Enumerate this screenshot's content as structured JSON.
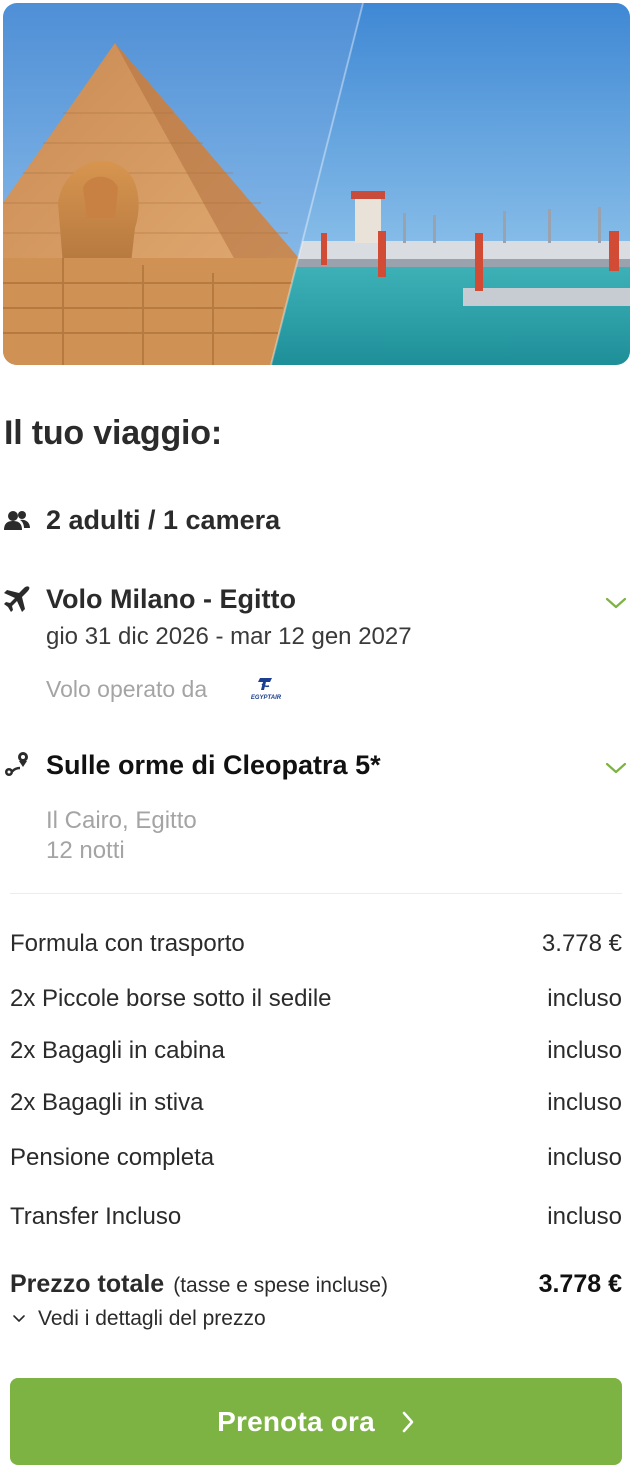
{
  "hero": {
    "image_alt": "Piramide e Sfinge / lungomare"
  },
  "trip": {
    "title": "Il tuo viaggio:",
    "guests": "2 adulti / 1 camera",
    "flight": {
      "title": "Volo Milano - Egitto",
      "dates": "gio 31 dic 2026 - mar 12 gen 2027",
      "operated_by": "Volo operato da",
      "airline_logo_text": "EGYPTAIR"
    },
    "tour": {
      "title": "Sulle orme di Cleopatra 5*",
      "location": "Il Cairo, Egitto",
      "nights": "12 notti"
    }
  },
  "price": {
    "rows": [
      {
        "label": "Formula con trasporto",
        "value": "3.778 €"
      },
      {
        "label": "2x Piccole borse sotto il sedile",
        "value": "incluso"
      },
      {
        "label": "2x Bagagli in cabina",
        "value": "incluso"
      },
      {
        "label": "2x Bagagli in stiva",
        "value": "incluso"
      },
      {
        "label": "Pensione completa",
        "value": "incluso"
      },
      {
        "label": "Transfer Incluso",
        "value": "incluso"
      }
    ],
    "total_label": "Prezzo totale",
    "total_note": "(tasse e spese incluse)",
    "total_value": "3.778 €",
    "details_link": "Vedi i dettagli del prezzo"
  },
  "cta": {
    "label": "Prenota ora"
  },
  "colors": {
    "accent": "#7cb342",
    "text": "#2b2b2b",
    "muted": "#a4a4a4"
  },
  "icons": [
    "users-icon",
    "airplane-icon",
    "route-pin-icon",
    "chevron-down-icon",
    "chevron-right-icon",
    "egyptair-logo"
  ]
}
